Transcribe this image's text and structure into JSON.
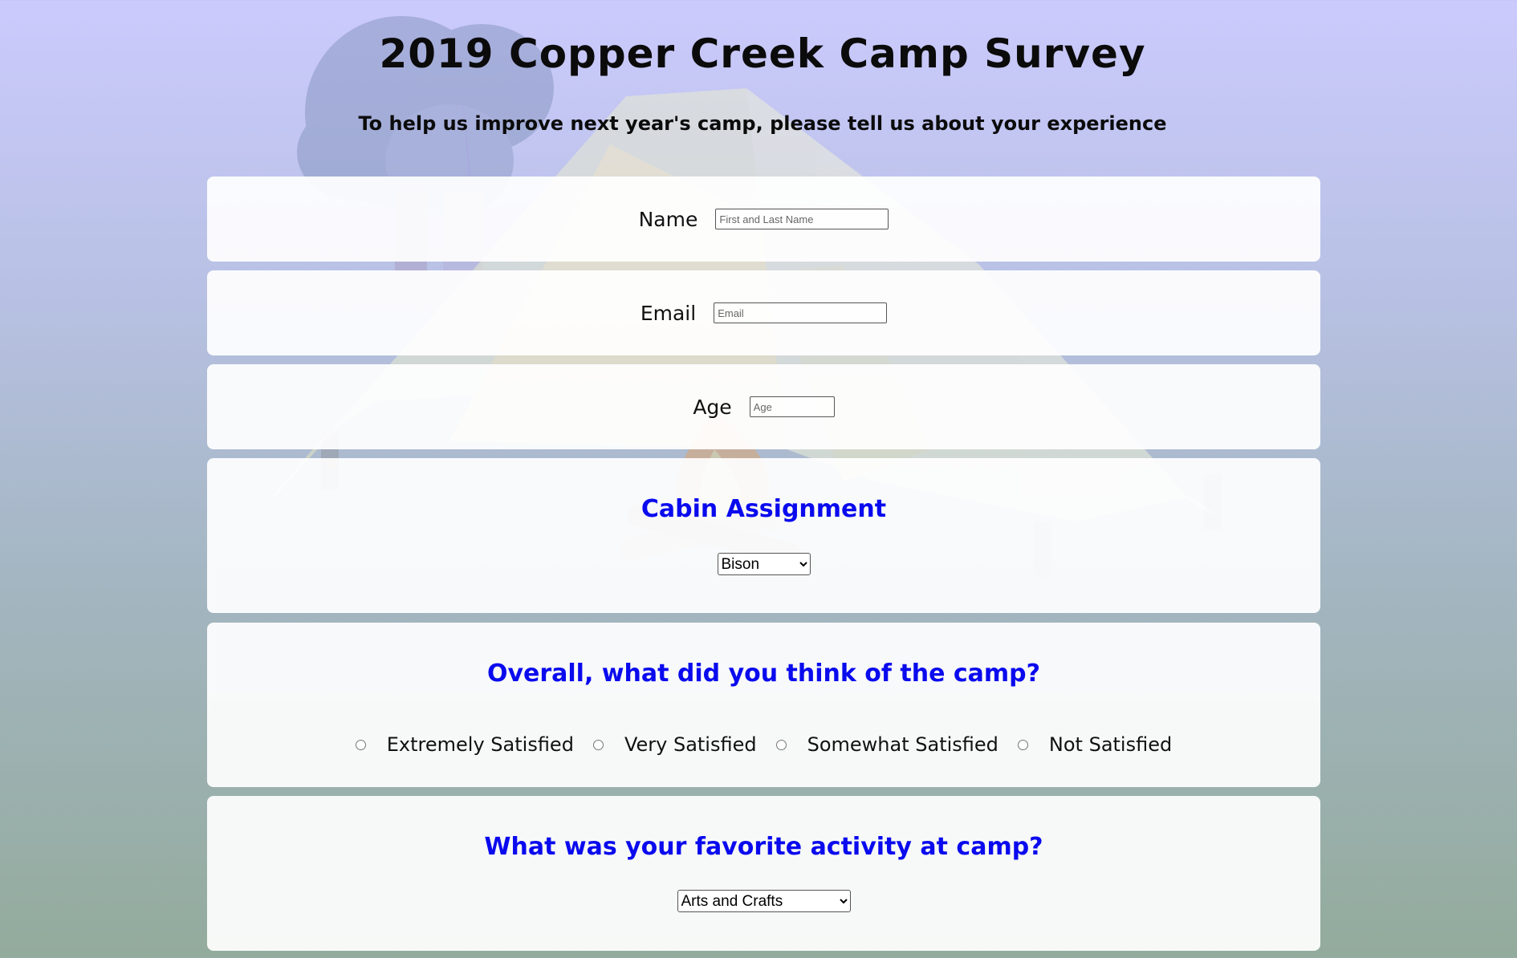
{
  "header": {
    "title": "2019 Copper Creek Camp Survey",
    "subtitle": "To help us improve next year's camp, please tell us about your experience"
  },
  "fields": {
    "name": {
      "label": "Name",
      "placeholder": "First and Last Name",
      "value": ""
    },
    "email": {
      "label": "Email",
      "placeholder": "Email",
      "value": ""
    },
    "age": {
      "label": "Age",
      "placeholder": "Age",
      "value": ""
    }
  },
  "cabin": {
    "heading": "Cabin Assignment",
    "selected": "Bison"
  },
  "overall": {
    "heading": "Overall, what did you think of the camp?",
    "options": [
      "Extremely Satisfied",
      "Very Satisfied",
      "Somewhat Satisfied",
      "Not Satisfied"
    ]
  },
  "activity": {
    "heading": "What was your favorite activity at camp?",
    "selected": "Arts and Crafts"
  },
  "colors": {
    "question_blue": "#0a0aee",
    "bg_top": "#cbcafd",
    "bg_bottom": "#93ab9c"
  }
}
